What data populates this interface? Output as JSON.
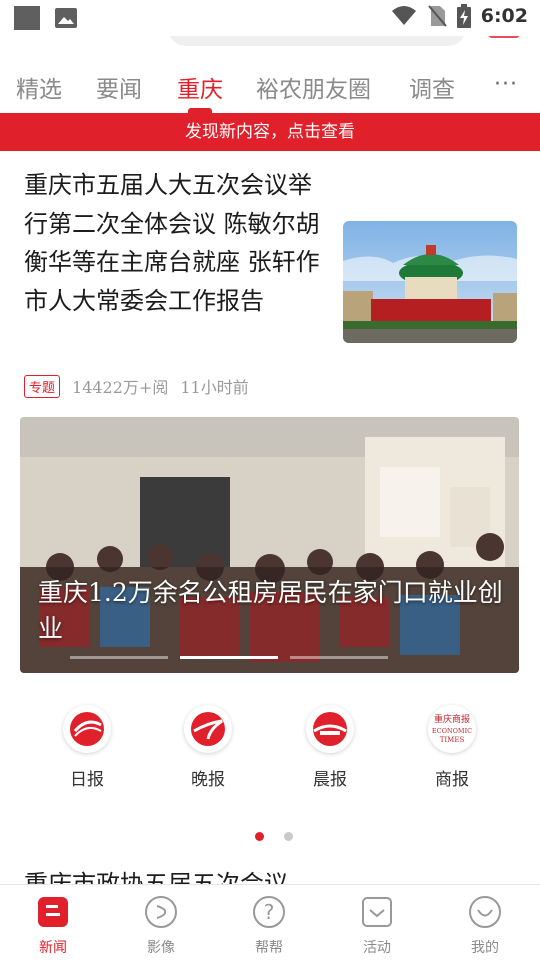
{
  "status_bar": {
    "time": "6:02",
    "icons": [
      "notification-square-icon",
      "image-icon",
      "wifi-icon",
      "no-sim-icon",
      "battery-charging-icon"
    ]
  },
  "tabs": [
    {
      "label": "精选"
    },
    {
      "label": "要闻"
    },
    {
      "label": "重庆",
      "active": true
    },
    {
      "label": "裕农朋友圈"
    },
    {
      "label": "调查"
    }
  ],
  "more_label": "···",
  "notice": "发现新内容，点击查看",
  "article1": {
    "title": "重庆市五届人大五次会议举行第二次全体会议 陈敏尔胡衡华等在主席台就座 张轩作市人大常委会工作报告",
    "tag": "专题",
    "reads": "14422万+阅",
    "time": "11小时前"
  },
  "banner": {
    "caption": "重庆1.2万余名公租房居民在家门口就业创业",
    "dots": 3,
    "active_dot": 1
  },
  "papers": [
    {
      "label": "日报",
      "icon": "daily-paper-icon"
    },
    {
      "label": "晚报",
      "icon": "evening-paper-icon"
    },
    {
      "label": "晨报",
      "icon": "morning-paper-icon"
    },
    {
      "label": "商报",
      "icon": "business-paper-icon",
      "logo_text": "重庆商报 ECONOMIC TIMES"
    }
  ],
  "pager": {
    "count": 2,
    "active": 0
  },
  "next_title": "重庆市政协五届五次会议",
  "bottom_nav": [
    {
      "label": "新闻",
      "active": true
    },
    {
      "label": "影像"
    },
    {
      "label": "帮帮"
    },
    {
      "label": "活动"
    },
    {
      "label": "我的"
    }
  ],
  "colors": {
    "accent": "#e0202a",
    "muted": "#8a8a8a"
  }
}
